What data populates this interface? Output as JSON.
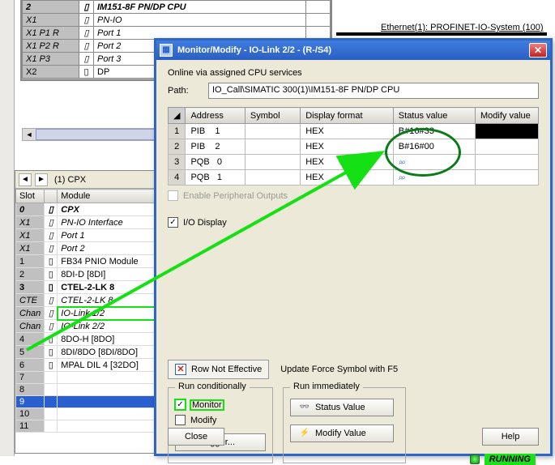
{
  "eth_label": "Ethernet(1): PROFINET-IO-System (100)",
  "hw_upper": {
    "rows": [
      {
        "slot": "2",
        "icon": "▯",
        "name": "IM151-8F PN/DP CPU",
        "bold": true,
        "ital": true
      },
      {
        "slot": "X1",
        "icon": "▯",
        "name": "PN-IO",
        "ital": true
      },
      {
        "slot": "X1 P1 R",
        "icon": "▯",
        "name": "Port 1",
        "ital": true
      },
      {
        "slot": "X1 P2 R",
        "icon": "▯",
        "name": "Port 2",
        "ital": true
      },
      {
        "slot": "X1 P3",
        "icon": "▯",
        "name": "Port 3",
        "ital": true
      },
      {
        "slot": "X2",
        "icon": "▯",
        "name": "DP",
        "ital": false
      }
    ]
  },
  "hw_lower": {
    "title": "(1)  CPX",
    "cols": {
      "slot": "Slot",
      "icon": "",
      "mod": "Module"
    },
    "rows": [
      {
        "slot": "0",
        "name": "CPX",
        "bold": true,
        "ital": true
      },
      {
        "slot": "X1",
        "name": "PN-IO Interface",
        "ital": true
      },
      {
        "slot": "X1",
        "name": "Port 1",
        "ital": true
      },
      {
        "slot": "X1",
        "name": "Port 2",
        "ital": true
      },
      {
        "slot": "1",
        "name": "FB34 PNIO Module"
      },
      {
        "slot": "2",
        "name": "8DI-D [8DI]"
      },
      {
        "slot": "3",
        "name": "CTEL-2-LK 8",
        "bold": true
      },
      {
        "slot": "CTE",
        "name": "CTEL-2-LK 8",
        "ital": true
      },
      {
        "slot": "Chan",
        "name": "IO-Link 1/2",
        "ital": true,
        "hl": true
      },
      {
        "slot": "Chan",
        "name": "IO-Link 2/2",
        "ital": true
      },
      {
        "slot": "4",
        "name": "8DO-H [8DO]"
      },
      {
        "slot": "5",
        "name": "8DI/8DO [8DI/8DO]"
      },
      {
        "slot": "6",
        "name": "MPAL DIL 4 [32DO]"
      },
      {
        "slot": "7",
        "name": ""
      },
      {
        "slot": "8",
        "name": ""
      },
      {
        "slot": "9",
        "name": "",
        "sel": true
      },
      {
        "slot": "10",
        "name": ""
      },
      {
        "slot": "11",
        "name": ""
      }
    ]
  },
  "dialog": {
    "title": "Monitor/Modify - IO-Link 2/2 - (R-/S4)",
    "online_line": "Online via assigned CPU services",
    "path_label": "Path:",
    "path_value": "IO_Call\\SIMATIC 300(1)\\IM151-8F PN/DP CPU",
    "headers": {
      "addr": "Address",
      "sym": "Symbol",
      "fmt": "Display format",
      "status": "Status value",
      "mod": "Modify value"
    },
    "rows": [
      {
        "n": "1",
        "addr": "PIB    1",
        "sym": "",
        "fmt": "HEX",
        "status": "B#16#33",
        "mod": ""
      },
      {
        "n": "2",
        "addr": "PIB    2",
        "sym": "",
        "fmt": "HEX",
        "status": "B#16#00",
        "mod": ""
      },
      {
        "n": "3",
        "addr": "PQB   0",
        "sym": "",
        "fmt": "HEX",
        "status": "⌕⌕",
        "mod": ""
      },
      {
        "n": "4",
        "addr": "PQB   1",
        "sym": "",
        "fmt": "HEX",
        "status": "⌕⌕",
        "mod": ""
      }
    ],
    "row_not_eff": "Row Not Effective",
    "update_force": "Update Force Symbol with F5",
    "gb1": "Run conditionally",
    "gb2": "Run immediately",
    "chk_monitor": "Monitor",
    "chk_modify": "Modify",
    "btn_trigger": "Trigger...",
    "btn_statusv": "Status Value",
    "btn_modifyv": "Modify Value",
    "chk_periph": "Enable Peripheral Outputs",
    "chk_iodisp": "I/O Display",
    "running": "RUNNING",
    "close": "Close",
    "help": "Help"
  }
}
